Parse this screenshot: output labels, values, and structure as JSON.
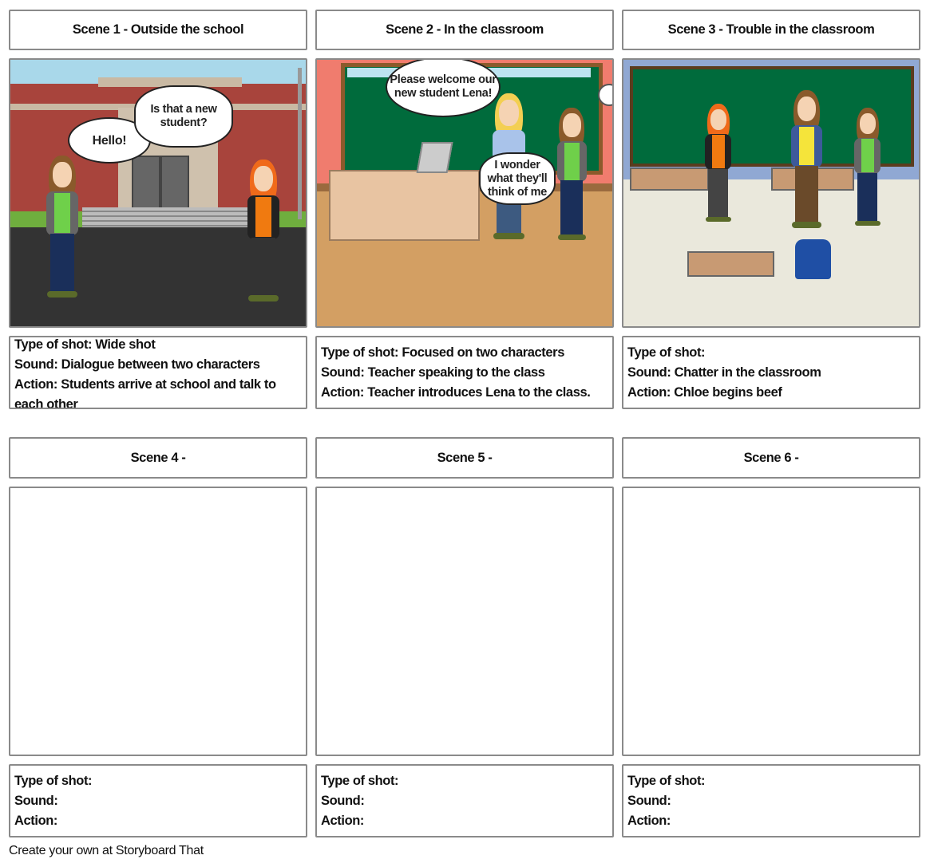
{
  "scenes": [
    {
      "title": "Scene 1 - Outside the school",
      "shot": "Type of shot: Wide shot",
      "sound": "Sound: Dialogue between two characters",
      "action": "Action: Students arrive at school and talk to each other",
      "bubbles": [
        "Hello!",
        "Is that a new student?"
      ]
    },
    {
      "title": "Scene 2 - In the classroom",
      "shot": "Type of shot: Focused on two characters",
      "sound": "Sound: Teacher speaking to the class",
      "action": "Action: Teacher introduces Lena to the class.",
      "bubbles": [
        "Please welcome our new student Lena!",
        "I wonder what they'll think of me"
      ]
    },
    {
      "title": "Scene 3 - Trouble in the classroom",
      "shot": "Type of shot:",
      "sound": "Sound: Chatter in the classroom",
      "action": "Action: Chloe begins beef"
    },
    {
      "title": "Scene 4  -",
      "shot": "Type of shot:",
      "sound": "Sound:",
      "action": "Action:"
    },
    {
      "title": "Scene 5 -",
      "shot": "Type of shot:",
      "sound": "Sound:",
      "action": "Action:"
    },
    {
      "title": "Scene 6 -",
      "shot": "Type of shot:",
      "sound": "Sound:",
      "action": "Action:"
    }
  ],
  "footer": "Create your own at Storyboard That"
}
